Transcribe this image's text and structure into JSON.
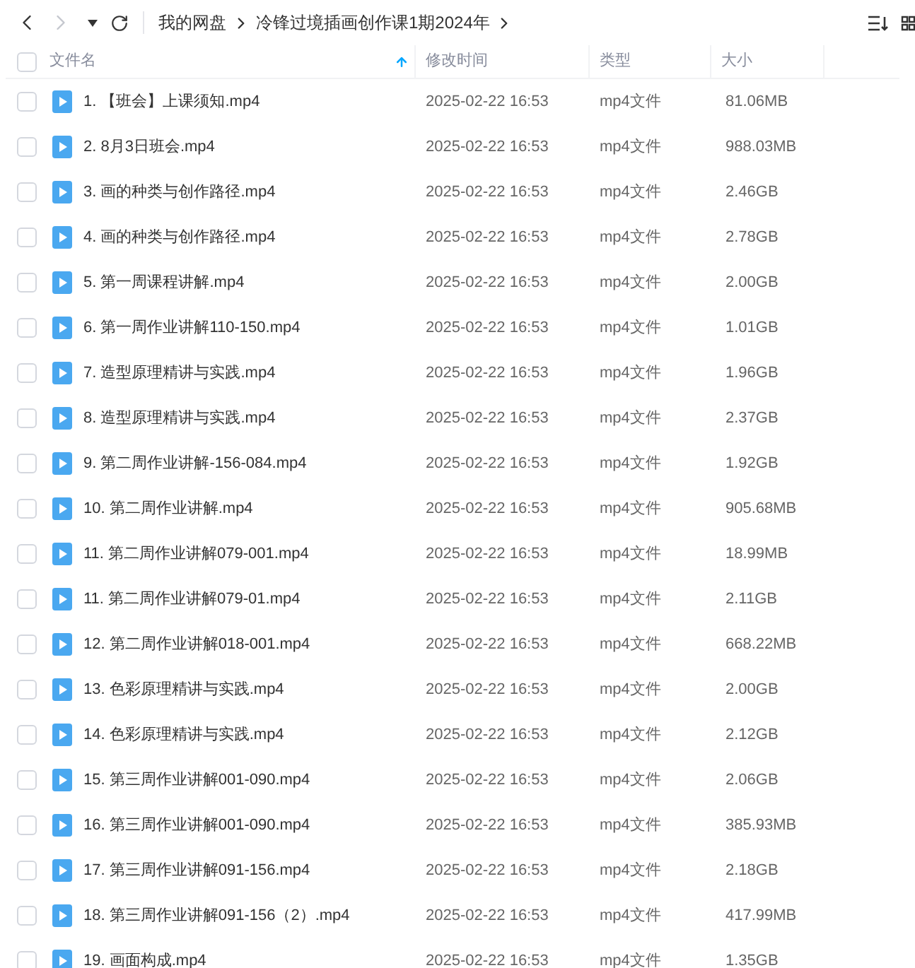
{
  "toolbar": {
    "back_disabled": false,
    "forward_disabled": true
  },
  "breadcrumb": [
    "我的网盘",
    "冷锋过境插画创作课1期2024年"
  ],
  "table": {
    "all_checked": false,
    "columns": [
      {
        "label": "文件名",
        "sorted": true
      },
      {
        "label": "修改时间",
        "sorted": false
      },
      {
        "label": "类型",
        "sorted": false
      },
      {
        "label": "大小",
        "sorted": false
      }
    ],
    "rows": [
      {
        "name": "1. 【班会】上课须知.mp4",
        "modified": "2025-02-22 16:53",
        "type": "mp4文件",
        "size": "81.06MB",
        "checked": false
      },
      {
        "name": "2. 8月3日班会.mp4",
        "modified": "2025-02-22 16:53",
        "type": "mp4文件",
        "size": "988.03MB",
        "checked": false
      },
      {
        "name": "3. 画的种类与创作路径.mp4",
        "modified": "2025-02-22 16:53",
        "type": "mp4文件",
        "size": "2.46GB",
        "checked": false
      },
      {
        "name": "4. 画的种类与创作路径.mp4",
        "modified": "2025-02-22 16:53",
        "type": "mp4文件",
        "size": "2.78GB",
        "checked": false
      },
      {
        "name": "5. 第一周课程讲解.mp4",
        "modified": "2025-02-22 16:53",
        "type": "mp4文件",
        "size": "2.00GB",
        "checked": false
      },
      {
        "name": "6. 第一周作业讲解110-150.mp4",
        "modified": "2025-02-22 16:53",
        "type": "mp4文件",
        "size": "1.01GB",
        "checked": false
      },
      {
        "name": "7. 造型原理精讲与实践.mp4",
        "modified": "2025-02-22 16:53",
        "type": "mp4文件",
        "size": "1.96GB",
        "checked": false
      },
      {
        "name": "8. 造型原理精讲与实践.mp4",
        "modified": "2025-02-22 16:53",
        "type": "mp4文件",
        "size": "2.37GB",
        "checked": false
      },
      {
        "name": "9. 第二周作业讲解-156-084.mp4",
        "modified": "2025-02-22 16:53",
        "type": "mp4文件",
        "size": "1.92GB",
        "checked": false
      },
      {
        "name": "10. 第二周作业讲解.mp4",
        "modified": "2025-02-22 16:53",
        "type": "mp4文件",
        "size": "905.68MB",
        "checked": false
      },
      {
        "name": "11. 第二周作业讲解079-001.mp4",
        "modified": "2025-02-22 16:53",
        "type": "mp4文件",
        "size": "18.99MB",
        "checked": false
      },
      {
        "name": "11. 第二周作业讲解079-01.mp4",
        "modified": "2025-02-22 16:53",
        "type": "mp4文件",
        "size": "2.11GB",
        "checked": false
      },
      {
        "name": "12. 第二周作业讲解018-001.mp4",
        "modified": "2025-02-22 16:53",
        "type": "mp4文件",
        "size": "668.22MB",
        "checked": false
      },
      {
        "name": "13. 色彩原理精讲与实践.mp4",
        "modified": "2025-02-22 16:53",
        "type": "mp4文件",
        "size": "2.00GB",
        "checked": false
      },
      {
        "name": "14. 色彩原理精讲与实践.mp4",
        "modified": "2025-02-22 16:53",
        "type": "mp4文件",
        "size": "2.12GB",
        "checked": false
      },
      {
        "name": "15. 第三周作业讲解001-090.mp4",
        "modified": "2025-02-22 16:53",
        "type": "mp4文件",
        "size": "2.06GB",
        "checked": false
      },
      {
        "name": "16. 第三周作业讲解001-090.mp4",
        "modified": "2025-02-22 16:53",
        "type": "mp4文件",
        "size": "385.93MB",
        "checked": false
      },
      {
        "name": "17. 第三周作业讲解091-156.mp4",
        "modified": "2025-02-22 16:53",
        "type": "mp4文件",
        "size": "2.18GB",
        "checked": false
      },
      {
        "name": "18. 第三周作业讲解091-156（2）.mp4",
        "modified": "2025-02-22 16:53",
        "type": "mp4文件",
        "size": "417.99MB",
        "checked": false
      },
      {
        "name": "19. 画面构成.mp4",
        "modified": "2025-02-22 16:53",
        "type": "mp4文件",
        "size": "1.35GB",
        "checked": false
      }
    ]
  }
}
